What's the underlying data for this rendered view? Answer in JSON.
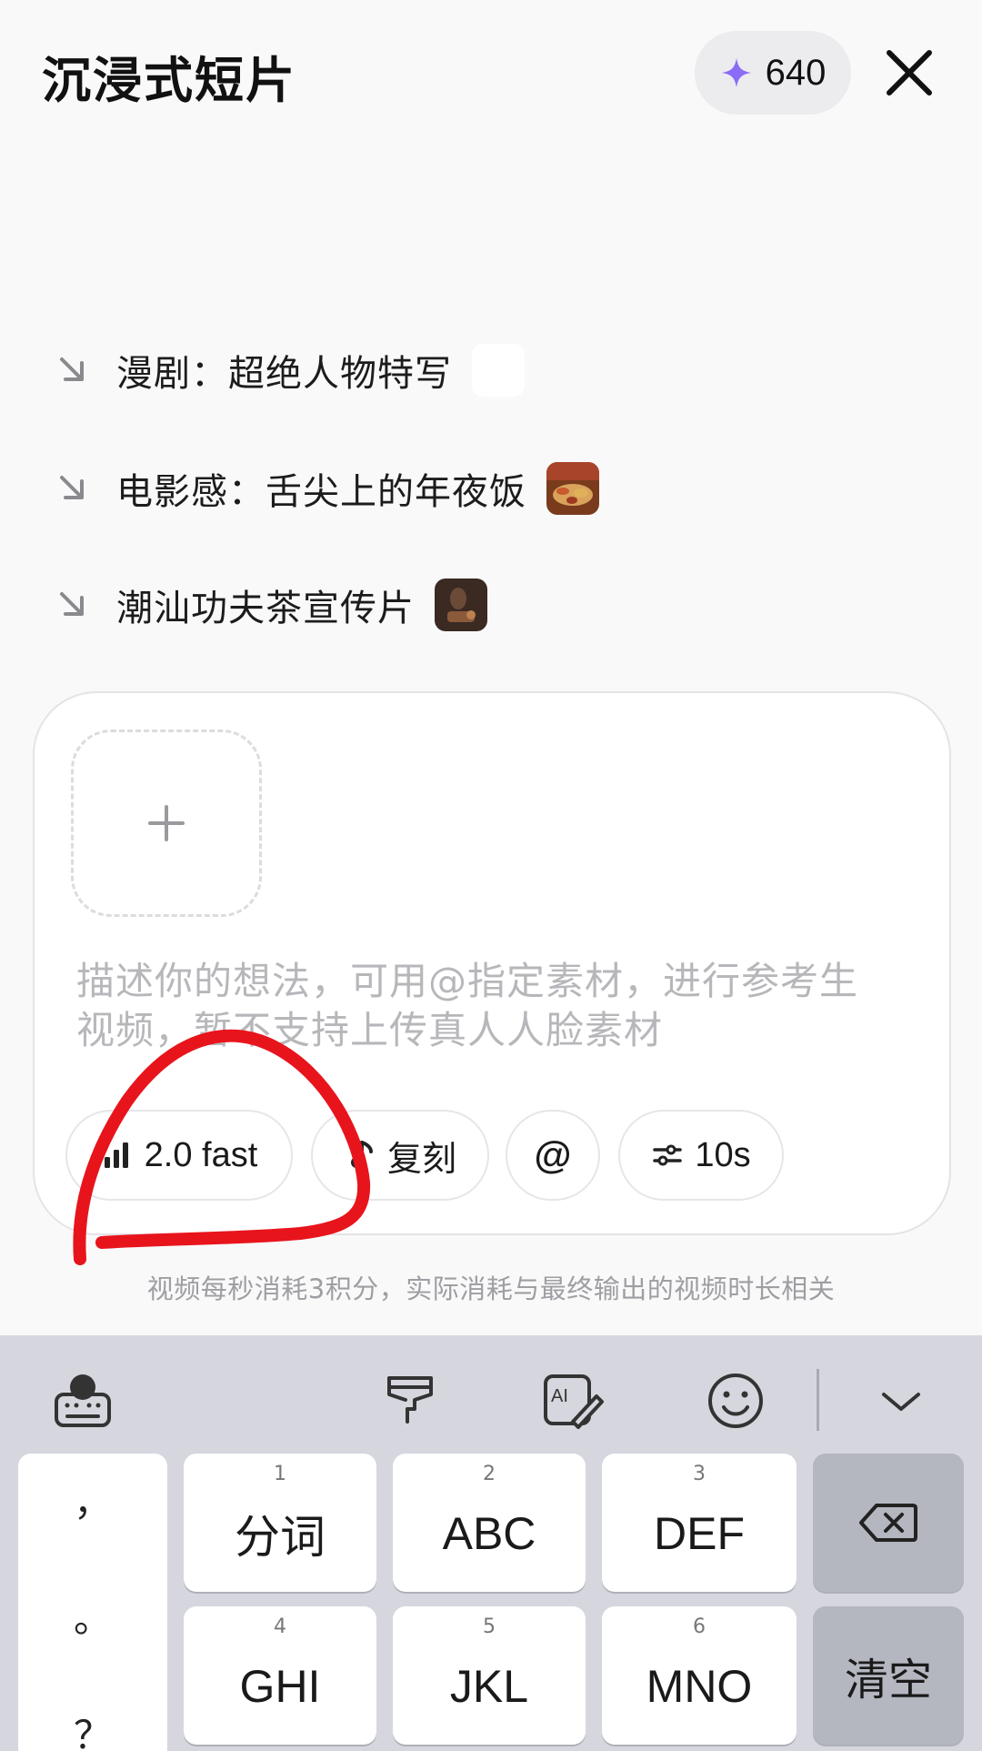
{
  "header": {
    "title": "沉浸式短片",
    "credits": "640",
    "close_icon": "close-icon",
    "sparkle_color": "#8b6cf6"
  },
  "suggestions": [
    {
      "label": "漫剧：超绝人物特写",
      "icon": "arrow-down-right-icon"
    },
    {
      "label": "电影感：舌尖上的年夜饭",
      "icon": "arrow-down-right-icon"
    },
    {
      "label": "潮汕功夫茶宣传片",
      "icon": "arrow-down-right-icon"
    }
  ],
  "composer": {
    "upload_icon": "plus-icon",
    "placeholder": "描述你的想法，可用@指定素材，进行参考生视频，暂不支持上传真人人脸素材",
    "chips": {
      "model": "2.0 fast",
      "replicate": "复刻",
      "mention": "@",
      "duration": "10s"
    }
  },
  "hint": "视频每秒消耗3积分，实际消耗与最终输出的视频时长相关",
  "annotation_color": "#e8141c",
  "keyboard": {
    "toolbar_icons": [
      "keyboard-language-icon",
      "brush-icon",
      "ai-write-icon",
      "emoji-icon",
      "chevron-down-icon"
    ],
    "punctuation": [
      "，",
      "。",
      "？"
    ],
    "keys_row1": [
      {
        "num": "1",
        "label": "分词"
      },
      {
        "num": "2",
        "label": "ABC"
      },
      {
        "num": "3",
        "label": "DEF"
      }
    ],
    "keys_row2": [
      {
        "num": "4",
        "label": "GHI"
      },
      {
        "num": "5",
        "label": "JKL"
      },
      {
        "num": "6",
        "label": "MNO"
      }
    ],
    "clear_label": "清空"
  }
}
